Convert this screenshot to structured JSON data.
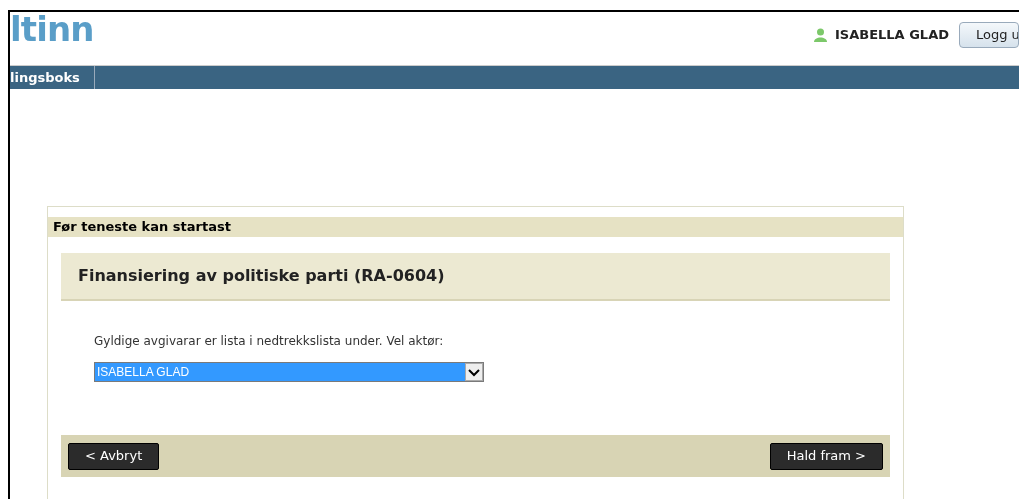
{
  "header": {
    "logo": "ltinn",
    "user": "ISABELLA GLAD",
    "logout_button": "Logg u"
  },
  "nav": {
    "items": [
      {
        "label": "lingsboks",
        "selected": true
      }
    ]
  },
  "dialog": {
    "title": "Før teneste kan startast",
    "service_title": "Finansiering av politiske parti (RA-0604)",
    "instruction": "Gyldige avgivarar er lista i nedtrekkslista under. Vel aktør:",
    "select": {
      "value": "ISABELLA GLAD"
    },
    "buttons": [
      {
        "label": "< Avbryt"
      },
      {
        "label": "Hald fram >"
      }
    ]
  }
}
